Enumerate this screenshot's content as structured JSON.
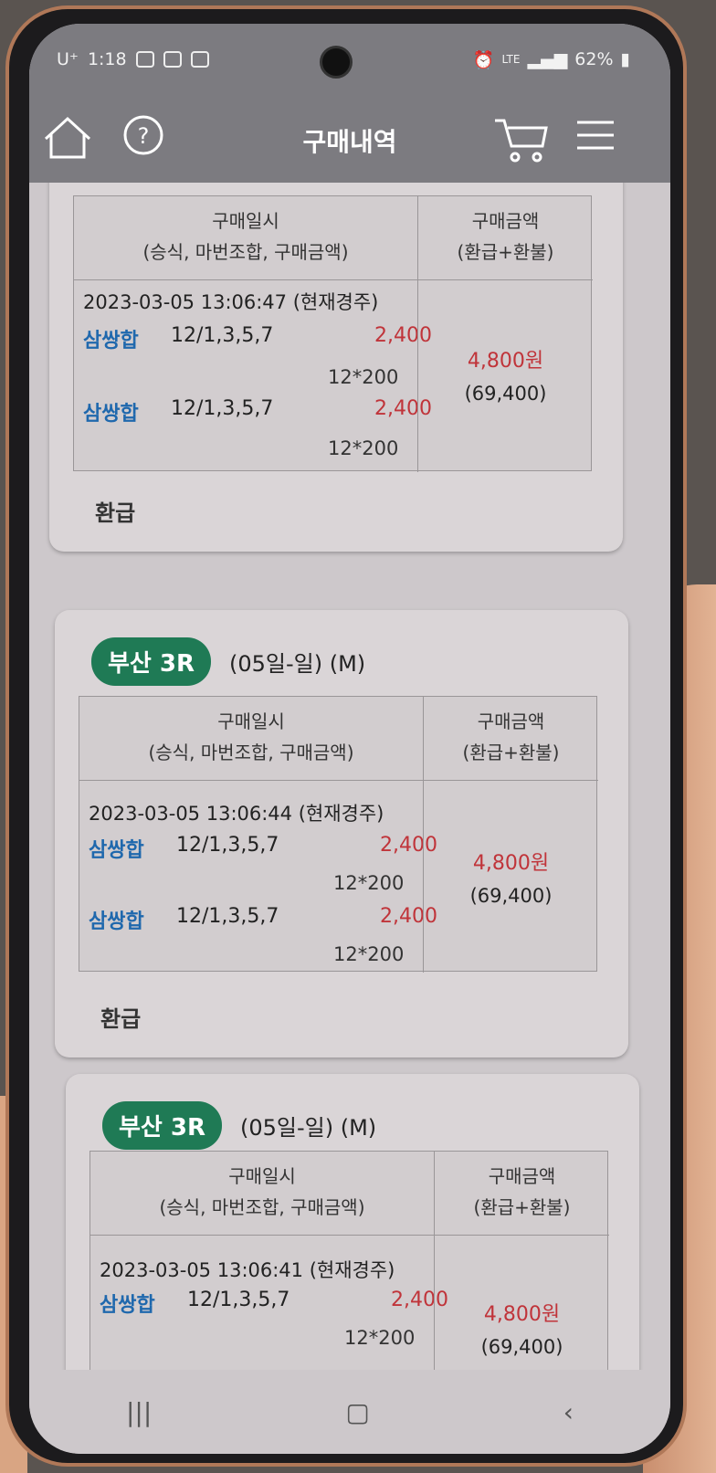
{
  "status": {
    "carrier": "U⁺",
    "time": "1:18",
    "network": "LTE",
    "battery": "62%"
  },
  "appbar": {
    "title": "구매내역",
    "icons": [
      "home-icon",
      "help-icon",
      "cart-icon",
      "menu-icon"
    ]
  },
  "table_headers": {
    "left_line1": "구매일시",
    "left_line2": "(승식, 마번조합, 구매금액)",
    "right_line1": "구매금액",
    "right_line2": "(환급+환불)"
  },
  "cards": [
    {
      "datetime": "2023-03-05 13:06:47 (현재경주)",
      "bets": [
        {
          "type": "삼쌍합",
          "combo": "12/1,3,5,7",
          "amount": "2,400",
          "mult": "12*200"
        },
        {
          "type": "삼쌍합",
          "combo": "12/1,3,5,7",
          "amount": "2,400",
          "mult": "12*200"
        }
      ],
      "total": "4,800원",
      "total_sub": "(69,400)",
      "status": "환급"
    },
    {
      "venue": "부산 3R",
      "info": "(05일-일) (M)",
      "datetime": "2023-03-05 13:06:44 (현재경주)",
      "bets": [
        {
          "type": "삼쌍합",
          "combo": "12/1,3,5,7",
          "amount": "2,400",
          "mult": "12*200"
        },
        {
          "type": "삼쌍합",
          "combo": "12/1,3,5,7",
          "amount": "2,400",
          "mult": "12*200"
        }
      ],
      "total": "4,800원",
      "total_sub": "(69,400)",
      "status": "환급"
    },
    {
      "venue": "부산 3R",
      "info": "(05일-일) (M)",
      "datetime": "2023-03-05 13:06:41 (현재경주)",
      "bets": [
        {
          "type": "삼쌍합",
          "combo": "12/1,3,5,7",
          "amount": "2,400",
          "mult": "12*200"
        }
      ],
      "total": "4,800원",
      "total_sub": "(69,400)"
    }
  ],
  "colors": {
    "accent_green": "#1f7a55",
    "amount_red": "#c0343a",
    "bet_blue": "#1f68ad"
  }
}
